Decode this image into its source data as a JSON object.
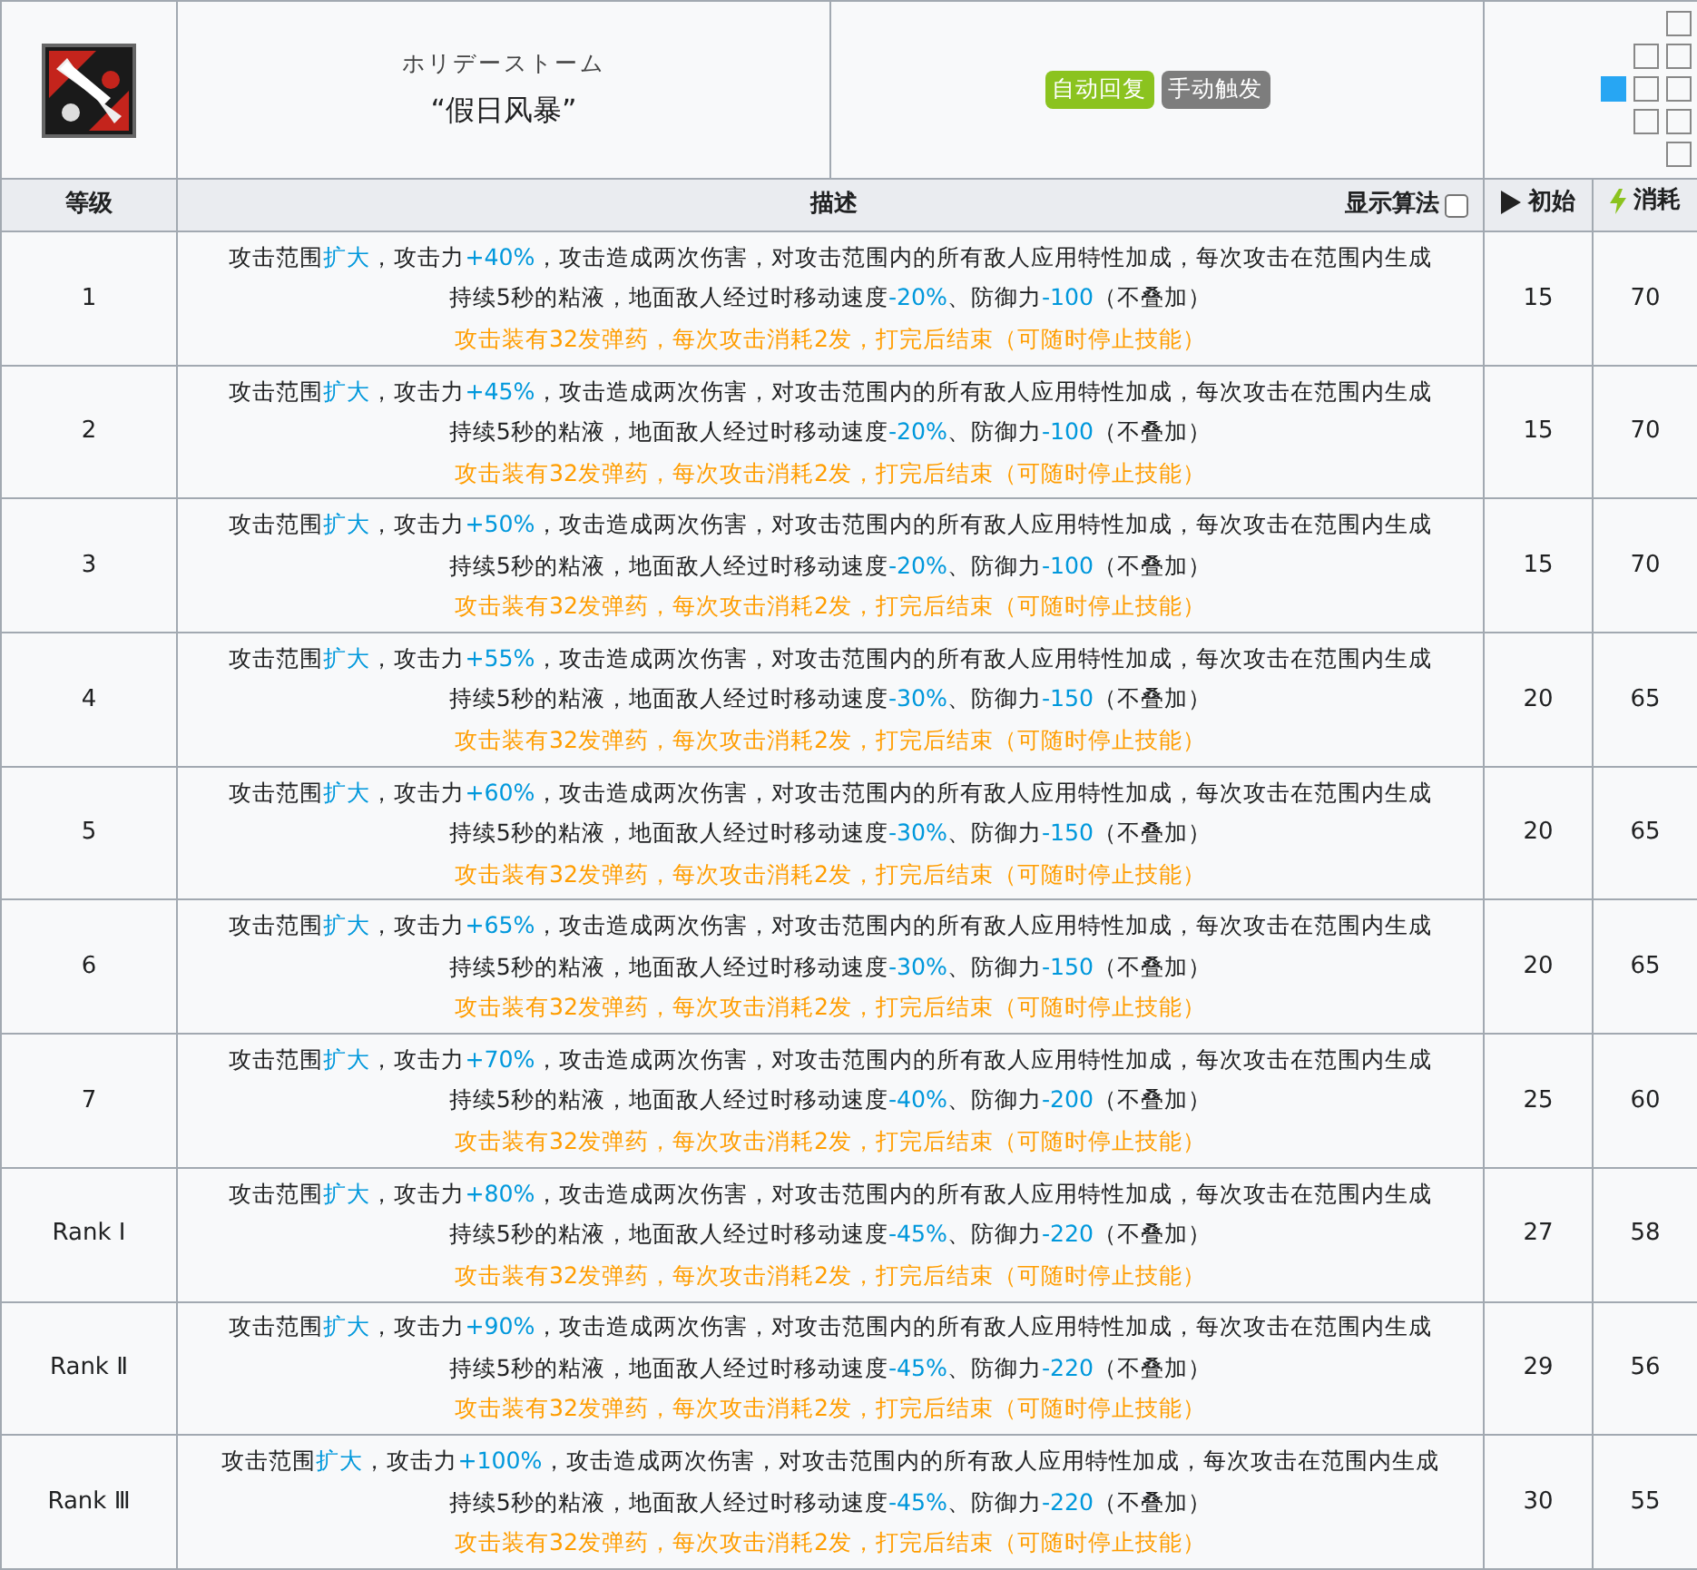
{
  "skill": {
    "name_jp": "ホリデーストーム",
    "name": "“假日风暴”",
    "tags": [
      {
        "label": "自动回复",
        "color": "#8bc31f"
      },
      {
        "label": "手动触发",
        "color": "#7d7d7d"
      }
    ],
    "attack_range": [
      {
        "cells": [
          {
            "kind": "none"
          },
          {
            "kind": "none"
          },
          {
            "kind": "tile"
          }
        ]
      },
      {
        "cells": [
          {
            "kind": "none"
          },
          {
            "kind": "tile"
          },
          {
            "kind": "tile"
          }
        ]
      },
      {
        "cells": [
          {
            "kind": "self"
          },
          {
            "kind": "tile"
          },
          {
            "kind": "tile"
          }
        ]
      },
      {
        "cells": [
          {
            "kind": "none"
          },
          {
            "kind": "tile"
          },
          {
            "kind": "tile"
          }
        ]
      },
      {
        "cells": [
          {
            "kind": "none"
          },
          {
            "kind": "none"
          },
          {
            "kind": "tile"
          }
        ]
      }
    ]
  },
  "table": {
    "columns": [
      "等级",
      "描述",
      "初始",
      "消耗"
    ],
    "show_formula": {
      "label": "显示算法",
      "checked": false
    },
    "rows": [
      {
        "level": "1",
        "description": [
          {
            "text": "攻击范围"
          },
          {
            "text": "扩大",
            "highlight": true
          },
          {
            "text": "，攻击力"
          },
          {
            "text": "+40%",
            "highlight": true
          },
          {
            "text": "，攻击造成两次伤害，对攻击范围内的所有敌人应用特性加成，每次攻击在范围内生成持续5秒的粘液，地面敌人经过时移动速度"
          },
          {
            "text": "-20%",
            "highlight": true
          },
          {
            "text": "、防御力"
          },
          {
            "text": "-100",
            "highlight": true
          },
          {
            "text": "（不叠加）"
          }
        ],
        "note": "攻击装有32发弹药，每次攻击消耗2发，打完后结束（可随时停止技能）",
        "initial": "15",
        "cost": "70"
      },
      {
        "level": "2",
        "description": [
          {
            "text": "攻击范围"
          },
          {
            "text": "扩大",
            "highlight": true
          },
          {
            "text": "，攻击力"
          },
          {
            "text": "+45%",
            "highlight": true
          },
          {
            "text": "，攻击造成两次伤害，对攻击范围内的所有敌人应用特性加成，每次攻击在范围内生成持续5秒的粘液，地面敌人经过时移动速度"
          },
          {
            "text": "-20%",
            "highlight": true
          },
          {
            "text": "、防御力"
          },
          {
            "text": "-100",
            "highlight": true
          },
          {
            "text": "（不叠加）"
          }
        ],
        "note": "攻击装有32发弹药，每次攻击消耗2发，打完后结束（可随时停止技能）",
        "initial": "15",
        "cost": "70"
      },
      {
        "level": "3",
        "description": [
          {
            "text": "攻击范围"
          },
          {
            "text": "扩大",
            "highlight": true
          },
          {
            "text": "，攻击力"
          },
          {
            "text": "+50%",
            "highlight": true
          },
          {
            "text": "，攻击造成两次伤害，对攻击范围内的所有敌人应用特性加成，每次攻击在范围内生成持续5秒的粘液，地面敌人经过时移动速度"
          },
          {
            "text": "-20%",
            "highlight": true
          },
          {
            "text": "、防御力"
          },
          {
            "text": "-100",
            "highlight": true
          },
          {
            "text": "（不叠加）"
          }
        ],
        "note": "攻击装有32发弹药，每次攻击消耗2发，打完后结束（可随时停止技能）",
        "initial": "15",
        "cost": "70"
      },
      {
        "level": "4",
        "description": [
          {
            "text": "攻击范围"
          },
          {
            "text": "扩大",
            "highlight": true
          },
          {
            "text": "，攻击力"
          },
          {
            "text": "+55%",
            "highlight": true
          },
          {
            "text": "，攻击造成两次伤害，对攻击范围内的所有敌人应用特性加成，每次攻击在范围内生成持续5秒的粘液，地面敌人经过时移动速度"
          },
          {
            "text": "-30%",
            "highlight": true
          },
          {
            "text": "、防御力"
          },
          {
            "text": "-150",
            "highlight": true
          },
          {
            "text": "（不叠加）"
          }
        ],
        "note": "攻击装有32发弹药，每次攻击消耗2发，打完后结束（可随时停止技能）",
        "initial": "20",
        "cost": "65"
      },
      {
        "level": "5",
        "description": [
          {
            "text": "攻击范围"
          },
          {
            "text": "扩大",
            "highlight": true
          },
          {
            "text": "，攻击力"
          },
          {
            "text": "+60%",
            "highlight": true
          },
          {
            "text": "，攻击造成两次伤害，对攻击范围内的所有敌人应用特性加成，每次攻击在范围内生成持续5秒的粘液，地面敌人经过时移动速度"
          },
          {
            "text": "-30%",
            "highlight": true
          },
          {
            "text": "、防御力"
          },
          {
            "text": "-150",
            "highlight": true
          },
          {
            "text": "（不叠加）"
          }
        ],
        "note": "攻击装有32发弹药，每次攻击消耗2发，打完后结束（可随时停止技能）",
        "initial": "20",
        "cost": "65"
      },
      {
        "level": "6",
        "description": [
          {
            "text": "攻击范围"
          },
          {
            "text": "扩大",
            "highlight": true
          },
          {
            "text": "，攻击力"
          },
          {
            "text": "+65%",
            "highlight": true
          },
          {
            "text": "，攻击造成两次伤害，对攻击范围内的所有敌人应用特性加成，每次攻击在范围内生成持续5秒的粘液，地面敌人经过时移动速度"
          },
          {
            "text": "-30%",
            "highlight": true
          },
          {
            "text": "、防御力"
          },
          {
            "text": "-150",
            "highlight": true
          },
          {
            "text": "（不叠加）"
          }
        ],
        "note": "攻击装有32发弹药，每次攻击消耗2发，打完后结束（可随时停止技能）",
        "initial": "20",
        "cost": "65"
      },
      {
        "level": "7",
        "description": [
          {
            "text": "攻击范围"
          },
          {
            "text": "扩大",
            "highlight": true
          },
          {
            "text": "，攻击力"
          },
          {
            "text": "+70%",
            "highlight": true
          },
          {
            "text": "，攻击造成两次伤害，对攻击范围内的所有敌人应用特性加成，每次攻击在范围内生成持续5秒的粘液，地面敌人经过时移动速度"
          },
          {
            "text": "-40%",
            "highlight": true
          },
          {
            "text": "、防御力"
          },
          {
            "text": "-200",
            "highlight": true
          },
          {
            "text": "（不叠加）"
          }
        ],
        "note": "攻击装有32发弹药，每次攻击消耗2发，打完后结束（可随时停止技能）",
        "initial": "25",
        "cost": "60"
      },
      {
        "level": "Rank Ⅰ",
        "description": [
          {
            "text": "攻击范围"
          },
          {
            "text": "扩大",
            "highlight": true
          },
          {
            "text": "，攻击力"
          },
          {
            "text": "+80%",
            "highlight": true
          },
          {
            "text": "，攻击造成两次伤害，对攻击范围内的所有敌人应用特性加成，每次攻击在范围内生成持续5秒的粘液，地面敌人经过时移动速度"
          },
          {
            "text": "-45%",
            "highlight": true
          },
          {
            "text": "、防御力"
          },
          {
            "text": "-220",
            "highlight": true
          },
          {
            "text": "（不叠加）"
          }
        ],
        "note": "攻击装有32发弹药，每次攻击消耗2发，打完后结束（可随时停止技能）",
        "initial": "27",
        "cost": "58"
      },
      {
        "level": "Rank Ⅱ",
        "description": [
          {
            "text": "攻击范围"
          },
          {
            "text": "扩大",
            "highlight": true
          },
          {
            "text": "，攻击力"
          },
          {
            "text": "+90%",
            "highlight": true
          },
          {
            "text": "，攻击造成两次伤害，对攻击范围内的所有敌人应用特性加成，每次攻击在范围内生成持续5秒的粘液，地面敌人经过时移动速度"
          },
          {
            "text": "-45%",
            "highlight": true
          },
          {
            "text": "、防御力"
          },
          {
            "text": "-220",
            "highlight": true
          },
          {
            "text": "（不叠加）"
          }
        ],
        "note": "攻击装有32发弹药，每次攻击消耗2发，打完后结束（可随时停止技能）",
        "initial": "29",
        "cost": "56"
      },
      {
        "level": "Rank Ⅲ",
        "description": [
          {
            "text": "攻击范围"
          },
          {
            "text": "扩大",
            "highlight": true
          },
          {
            "text": "，攻击力"
          },
          {
            "text": "+100%",
            "highlight": true
          },
          {
            "text": "，攻击造成两次伤害，对攻击范围内的所有敌人应用特性加成，每次攻击在范围内生成持续5秒的粘液，地面敌人经过时移动速度"
          },
          {
            "text": "-45%",
            "highlight": true
          },
          {
            "text": "、防御力"
          },
          {
            "text": "-220",
            "highlight": true
          },
          {
            "text": "（不叠加）"
          }
        ],
        "note": "攻击装有32发弹药，每次攻击消耗2发，打完后结束（可随时停止技能）",
        "initial": "30",
        "cost": "55"
      }
    ]
  }
}
